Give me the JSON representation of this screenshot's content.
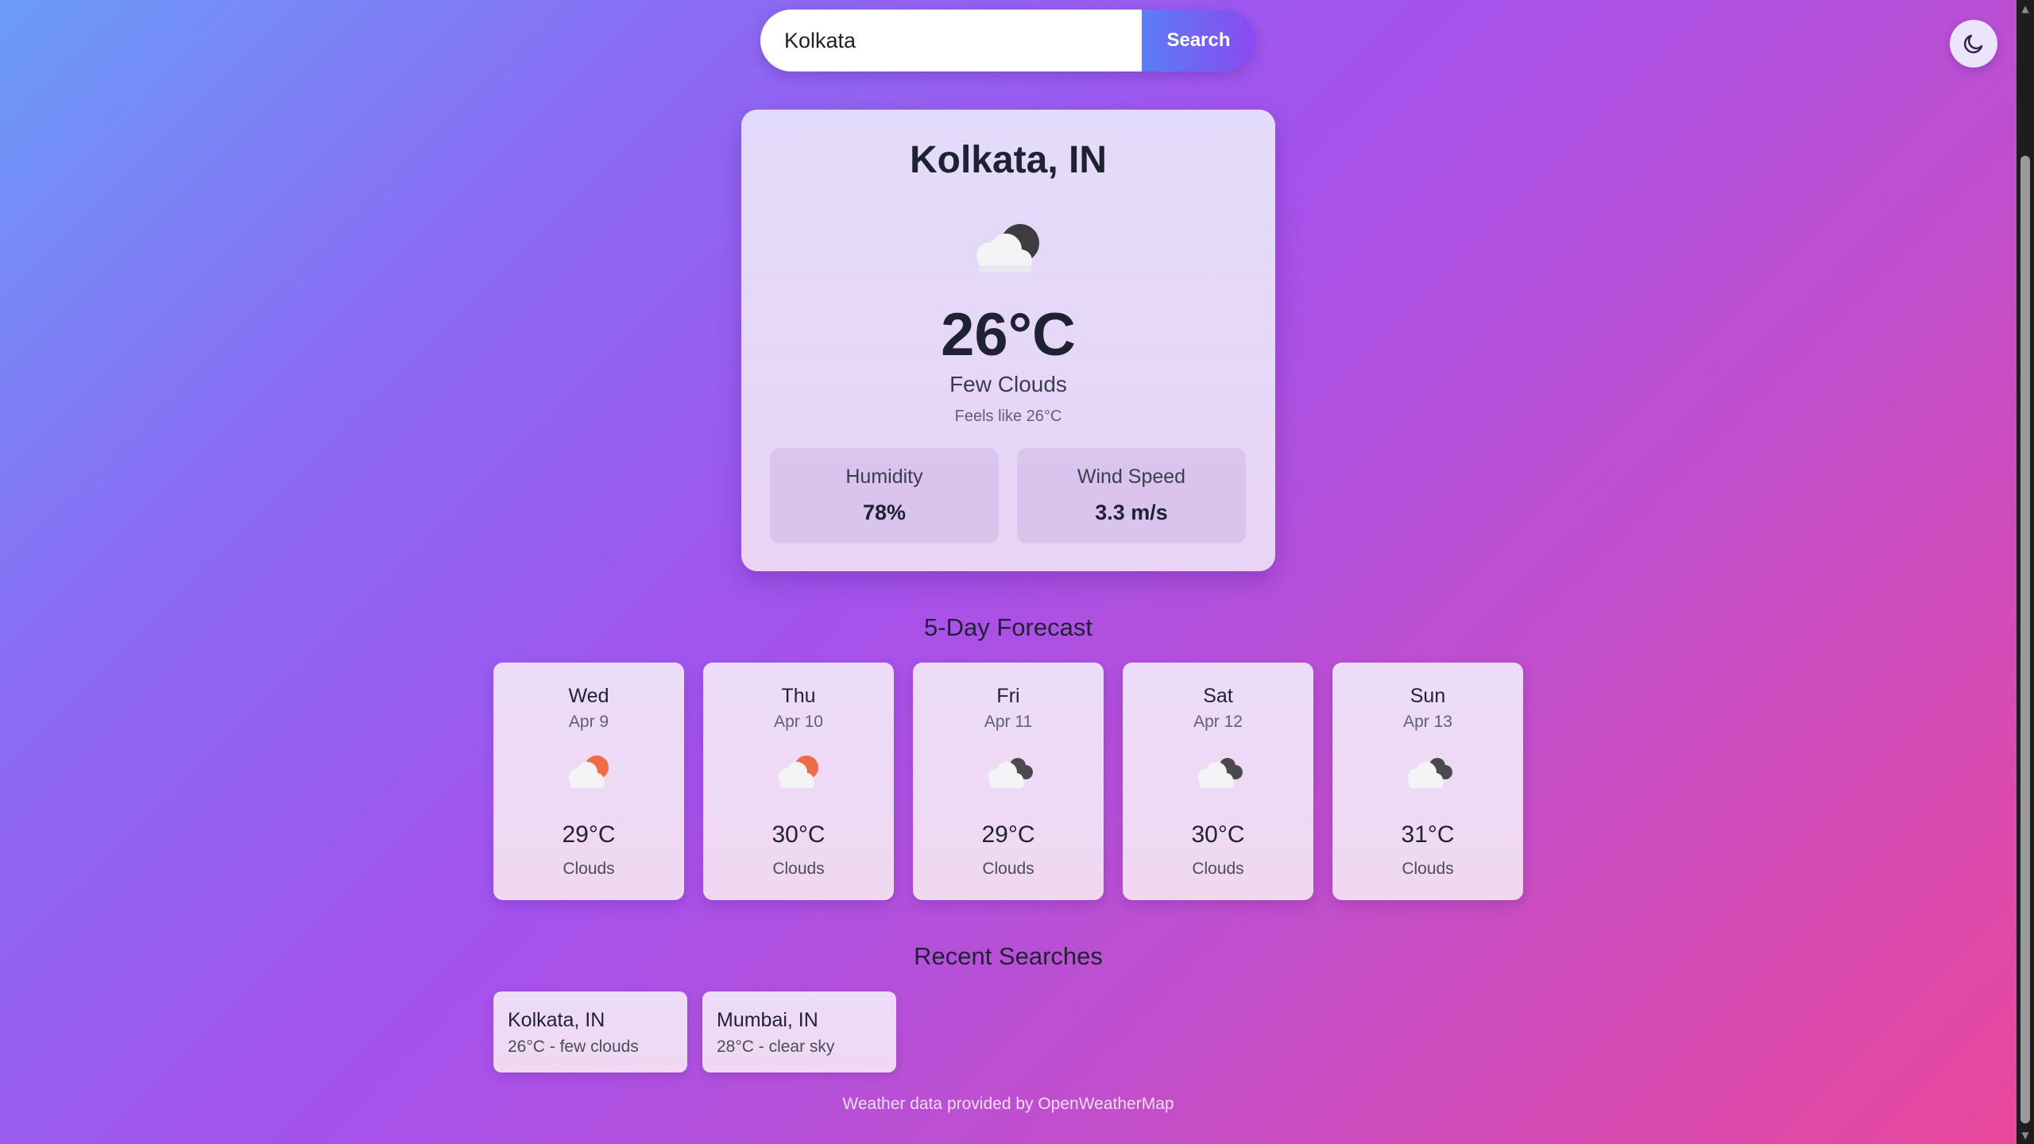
{
  "search": {
    "value": "Kolkata",
    "button_label": "Search"
  },
  "theme_toggle": {
    "icon": "moon-icon"
  },
  "current": {
    "city": "Kolkata, IN",
    "icon": "cloud-moon-icon",
    "temperature": "26°C",
    "description": "Few Clouds",
    "feels_like": "Feels like 26°C",
    "humidity_label": "Humidity",
    "humidity_value": "78%",
    "wind_label": "Wind Speed",
    "wind_value": "3.3 m/s"
  },
  "forecast": {
    "title": "5-Day Forecast",
    "days": [
      {
        "day": "Wed",
        "date": "Apr 9",
        "icon": "cloud-sun-icon",
        "temp": "29°C",
        "desc": "Clouds"
      },
      {
        "day": "Thu",
        "date": "Apr 10",
        "icon": "cloud-sun-icon",
        "temp": "30°C",
        "desc": "Clouds"
      },
      {
        "day": "Fri",
        "date": "Apr 11",
        "icon": "broken-clouds-icon",
        "temp": "29°C",
        "desc": "Clouds"
      },
      {
        "day": "Sat",
        "date": "Apr 12",
        "icon": "broken-clouds-icon",
        "temp": "30°C",
        "desc": "Clouds"
      },
      {
        "day": "Sun",
        "date": "Apr 13",
        "icon": "broken-clouds-icon",
        "temp": "31°C",
        "desc": "Clouds"
      }
    ]
  },
  "recent": {
    "title": "Recent Searches",
    "items": [
      {
        "city": "Kolkata, IN",
        "detail": "26°C - few clouds"
      },
      {
        "city": "Mumbai, IN",
        "detail": "28°C - clear sky"
      }
    ]
  },
  "footer": {
    "text": "Weather data provided by OpenWeatherMap"
  },
  "colors": {
    "accent_start": "#5b7df6",
    "accent_end": "#8a4af0",
    "sun": "#ee6c4a",
    "dark_cloud": "#4a4a4e"
  }
}
